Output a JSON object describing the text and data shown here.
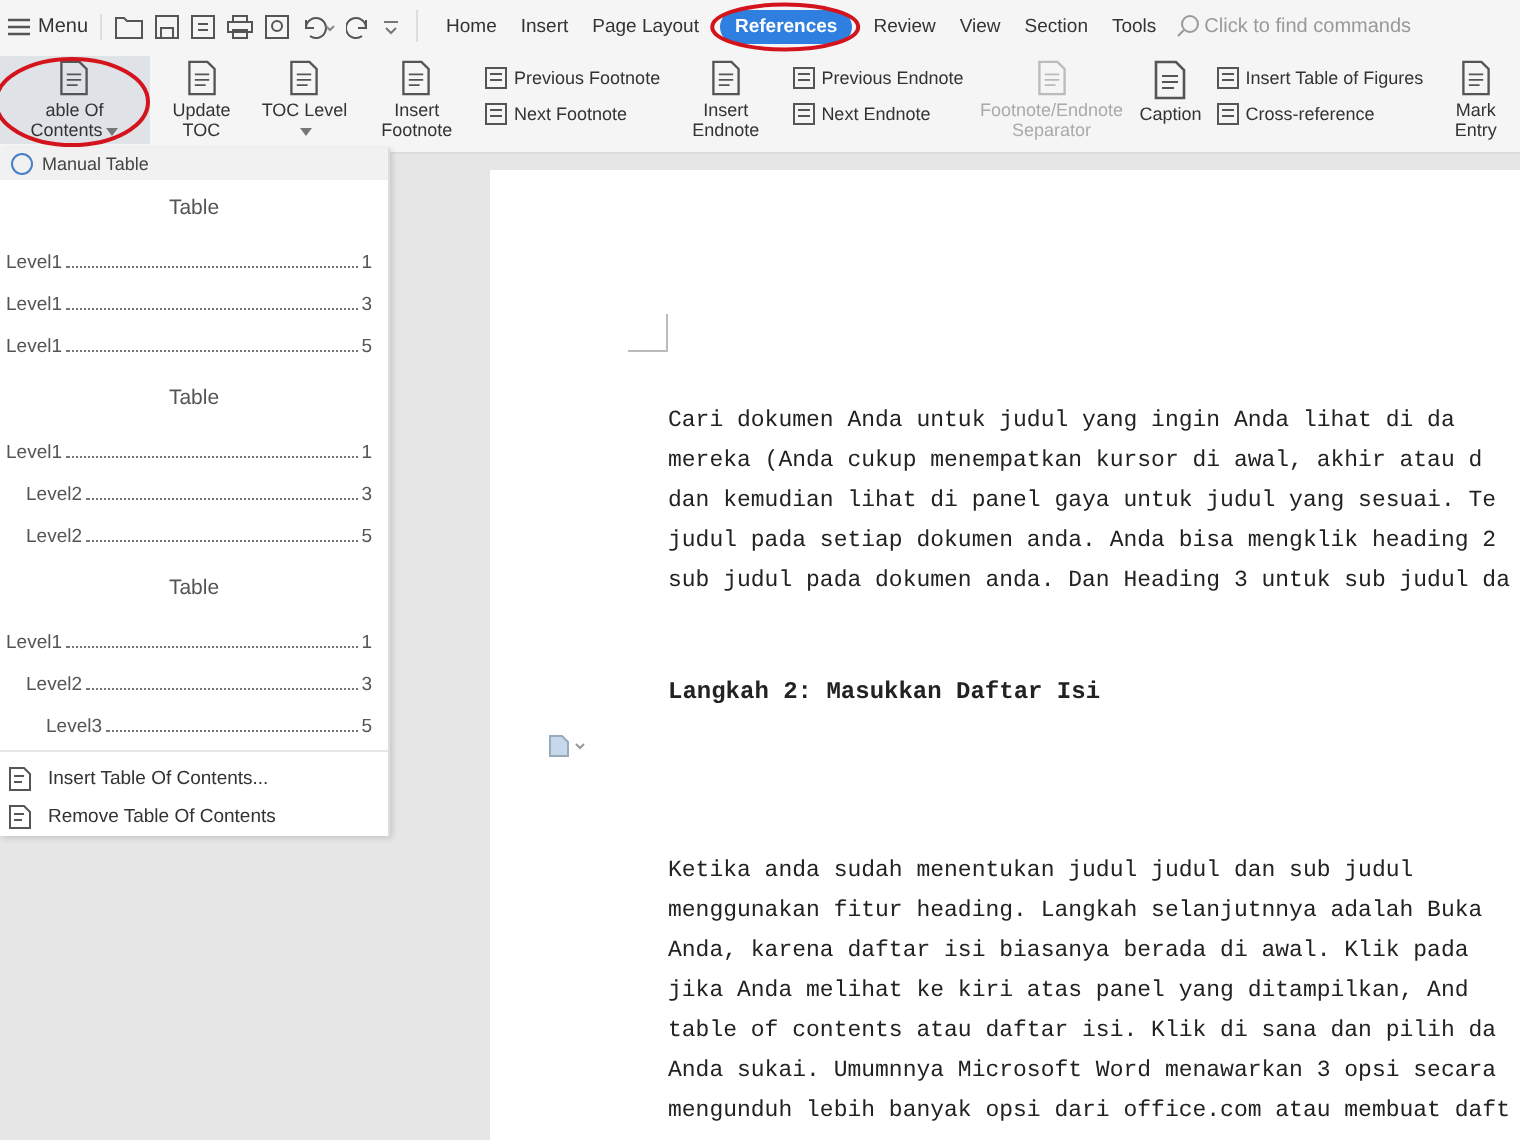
{
  "menu_bar": {
    "menu": "Menu",
    "tabs": [
      {
        "label": "Home",
        "selected": false
      },
      {
        "label": "Insert",
        "selected": false
      },
      {
        "label": "Page Layout",
        "selected": false
      },
      {
        "label": "References",
        "selected": true
      },
      {
        "label": "Review",
        "selected": false
      },
      {
        "label": "View",
        "selected": false
      },
      {
        "label": "Section",
        "selected": false
      },
      {
        "label": "Tools",
        "selected": false
      }
    ],
    "search": {
      "placeholder": "Click to find commands"
    }
  },
  "ribbon": {
    "groups": [
      {
        "kind": "large",
        "label": "able Of Contents",
        "caret": true,
        "selected": true,
        "disabled": false
      },
      {
        "kind": "large",
        "label": "Update TOC",
        "caret": false,
        "selected": false,
        "disabled": false
      },
      {
        "kind": "large",
        "label": "TOC Level",
        "caret": true,
        "selected": false,
        "disabled": false
      },
      {
        "kind": "large",
        "label": "Insert Footnote",
        "caret": false,
        "selected": false,
        "disabled": false
      },
      {
        "kind": "pair",
        "items": [
          "Previous Footnote",
          "Next Footnote"
        ]
      },
      {
        "kind": "large",
        "label": "Insert Endnote",
        "caret": false,
        "selected": false,
        "disabled": false
      },
      {
        "kind": "pair",
        "items": [
          "Previous Endnote",
          "Next Endnote"
        ]
      },
      {
        "kind": "large",
        "label": "Footnote/Endnote Separator",
        "caret": false,
        "selected": false,
        "disabled": true
      },
      {
        "kind": "large",
        "label": "Caption",
        "caret": false,
        "selected": false,
        "disabled": false
      },
      {
        "kind": "pair",
        "items": [
          "Insert Table of Figures",
          "Cross-reference"
        ]
      },
      {
        "kind": "large",
        "label": "Mark Entry",
        "caret": false,
        "selected": false,
        "disabled": false
      }
    ]
  },
  "toc_menu": {
    "header": "Manual Table",
    "styles": [
      {
        "title": "Table",
        "entries": [
          {
            "label": "Level1",
            "page": "1"
          },
          {
            "label": "Level1",
            "page": "3"
          },
          {
            "label": "Level1",
            "page": "5"
          }
        ]
      },
      {
        "title": "Table",
        "entries": [
          {
            "label": "Level1",
            "page": "1",
            "children": [
              {
                "label": "Level2",
                "page": "3"
              },
              {
                "label": "Level2",
                "page": "5"
              }
            ]
          }
        ]
      },
      {
        "title": "Table",
        "entries": [
          {
            "label": "Level1",
            "page": "1",
            "children": [
              {
                "label": "Level2",
                "page": "3",
                "children": [
                  {
                    "label": "Level3",
                    "page": "5"
                  }
                ]
              }
            ]
          }
        ]
      }
    ],
    "actions": [
      "Insert Table Of Contents...",
      "Remove Table Of Contents"
    ]
  },
  "document": {
    "paragraphs": [
      {
        "kind": "body",
        "lines": [
          "Cari dokumen Anda untuk judul yang ingin Anda lihat di da",
          "mereka (Anda cukup menempatkan kursor di awal, akhir atau d",
          "dan kemudian lihat di panel gaya untuk judul yang sesuai. Te",
          "judul pada setiap dokumen anda. Anda bisa mengklik heading 2",
          "sub judul pada dokumen anda. Dan Heading 3 untuk sub judul da"
        ]
      },
      {
        "kind": "heading",
        "lines": [
          "Langkah 2: Masukkan Daftar Isi"
        ]
      },
      {
        "kind": "body",
        "lines": [
          "Ketika anda sudah menentukan judul judul dan sub judul",
          "menggunakan fitur heading. Langkah selanjutnnya adalah Buka",
          "Anda, karena daftar isi biasanya berada di awal. Klik pada",
          "jika Anda melihat ke kiri atas panel yang ditampilkan, And",
          "table of contents atau daftar isi. Klik di sana dan pilih da",
          "Anda sukai. Umumnnya Microsoft Word menawarkan 3 opsi secara",
          "mengunduh lebih banyak opsi dari office.com atau membuat daft"
        ]
      }
    ]
  }
}
